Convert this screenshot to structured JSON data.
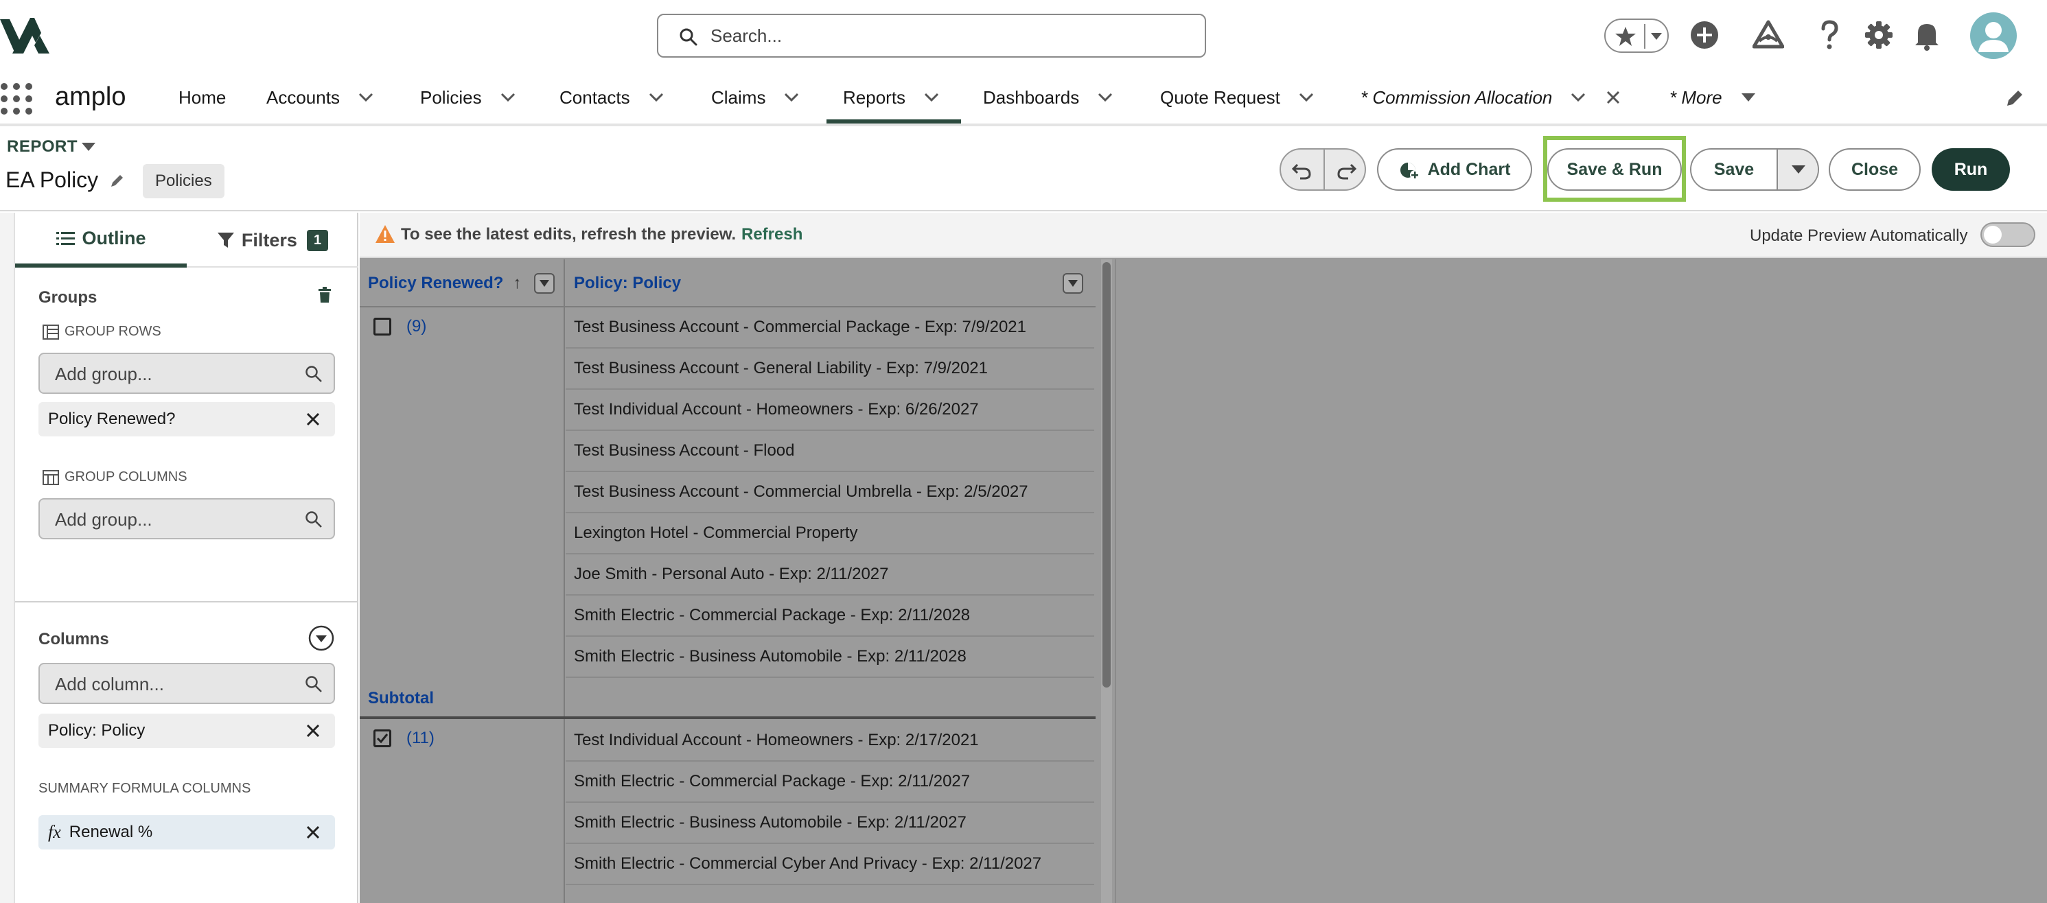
{
  "global_header": {
    "search_placeholder": "Search...",
    "icons": [
      "brand-logo",
      "search-icon",
      "star-icon",
      "chevron-down-icon",
      "add-icon",
      "trailhead-icon",
      "help-icon",
      "gear-icon",
      "bell-icon",
      "avatar"
    ]
  },
  "app_nav": {
    "app_name": "amplo",
    "tabs": [
      {
        "label": "Home",
        "has_menu": false,
        "active": false
      },
      {
        "label": "Accounts",
        "has_menu": true,
        "active": false
      },
      {
        "label": "Policies",
        "has_menu": true,
        "active": false
      },
      {
        "label": "Contacts",
        "has_menu": true,
        "active": false
      },
      {
        "label": "Claims",
        "has_menu": true,
        "active": false
      },
      {
        "label": "Reports",
        "has_menu": true,
        "active": true
      },
      {
        "label": "Dashboards",
        "has_menu": true,
        "active": false
      },
      {
        "label": "Quote Request",
        "has_menu": true,
        "active": false
      },
      {
        "label": "* Commission Allocation",
        "has_menu": true,
        "closable": true,
        "italic": true
      },
      {
        "label": "* More",
        "has_menu": true,
        "italic": true
      }
    ]
  },
  "report_header": {
    "label": "REPORT",
    "title": "EA Policy",
    "report_type": "Policies",
    "buttons": {
      "add_chart": "Add Chart",
      "save_run": "Save & Run",
      "save": "Save",
      "close": "Close",
      "run": "Run"
    }
  },
  "left_panel": {
    "tabs": {
      "outline": "Outline",
      "filters": "Filters",
      "filters_count": "1"
    },
    "groups": {
      "title": "Groups",
      "group_rows_label": "GROUP ROWS",
      "group_rows_placeholder": "Add group...",
      "group_rows_chip": "Policy Renewed?",
      "group_columns_label": "GROUP COLUMNS",
      "group_columns_placeholder": "Add group..."
    },
    "columns": {
      "title": "Columns",
      "placeholder": "Add column...",
      "chip": "Policy: Policy",
      "summary_label": "SUMMARY FORMULA COLUMNS",
      "summary_fx": "fx",
      "summary_chip": "Renewal %"
    }
  },
  "preview": {
    "warning": "To see the latest edits, refresh the preview.",
    "refresh": "Refresh",
    "auto_update_label": "Update Preview Automatically",
    "auto_update_on": false,
    "columns": [
      "Policy Renewed?",
      "Policy: Policy"
    ],
    "sort_indicator": "↑",
    "groups": [
      {
        "count": "(9)",
        "checked": false,
        "rows": [
          "Test Business Account - Commercial Package - Exp: 7/9/2021",
          "Test Business Account - General Liability - Exp: 7/9/2021",
          "Test Individual Account - Homeowners - Exp: 6/26/2027",
          "Test Business Account - Flood",
          "Test Business Account - Commercial Umbrella - Exp: 2/5/2027",
          "Lexington Hotel - Commercial Property",
          "Joe Smith - Personal Auto - Exp: 2/11/2027",
          "Smith Electric - Commercial Package - Exp: 2/11/2028",
          "Smith Electric - Business Automobile - Exp: 2/11/2028"
        ]
      },
      {
        "count": "(11)",
        "checked": true,
        "rows": [
          "Test Individual Account - Homeowners - Exp: 2/17/2021",
          "Smith Electric - Commercial Package - Exp: 2/11/2027",
          "Smith Electric - Business Automobile - Exp: 2/11/2027",
          "Smith Electric - Commercial Cyber And Privacy - Exp: 2/11/2027"
        ]
      }
    ],
    "subtotal_label": "Subtotal"
  },
  "colors": {
    "brand_dark": "#1d3b33",
    "brand_green": "#2c4a3e",
    "highlight": "#8dc44e",
    "link_blue": "#0b3d91",
    "preview_overlay": "#9b9b9b"
  }
}
